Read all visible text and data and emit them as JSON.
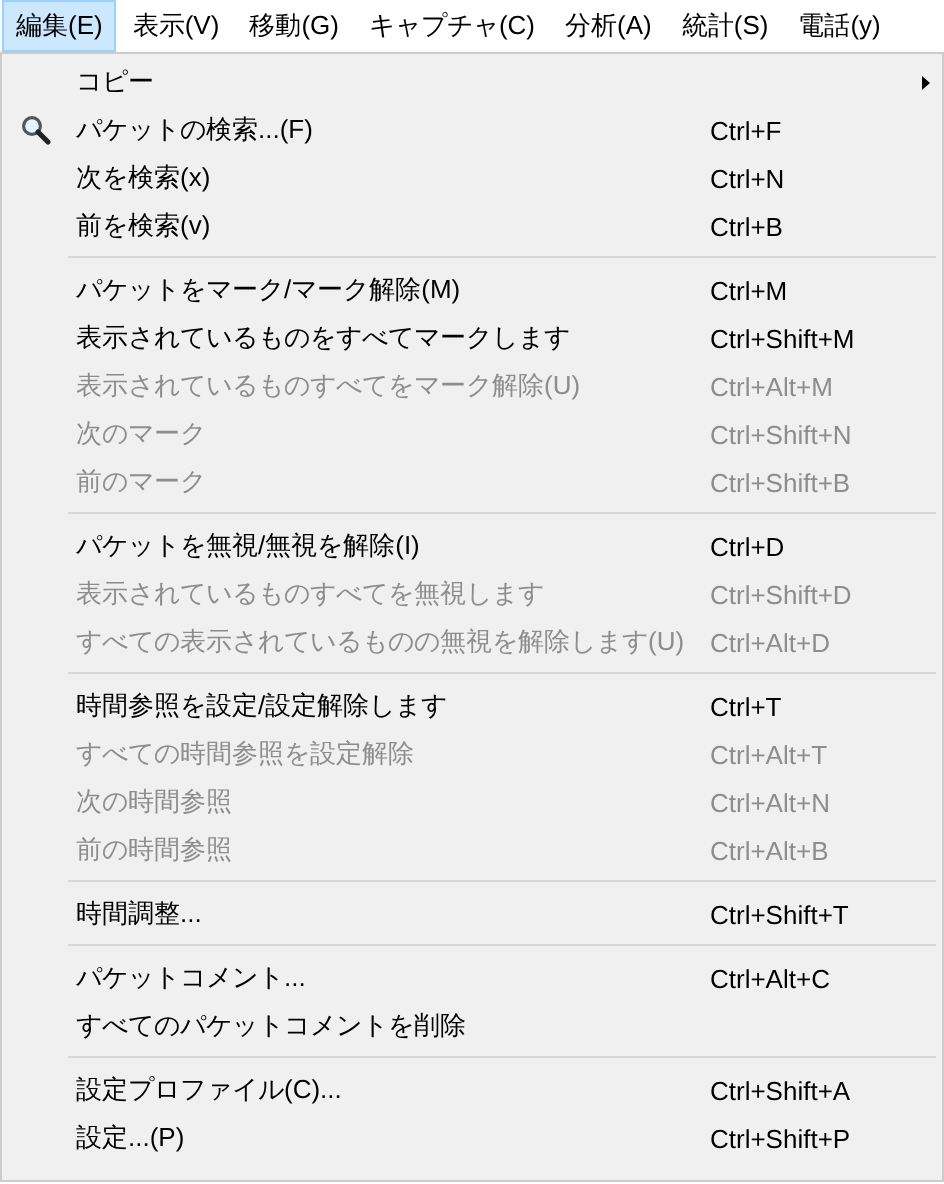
{
  "menubar": [
    {
      "label": "編集(E)",
      "selected": true
    },
    {
      "label": "表示(V)",
      "selected": false
    },
    {
      "label": "移動(G)",
      "selected": false
    },
    {
      "label": "キャプチャ(C)",
      "selected": false
    },
    {
      "label": "分析(A)",
      "selected": false
    },
    {
      "label": "統計(S)",
      "selected": false
    },
    {
      "label": "電話(y)",
      "selected": false
    }
  ],
  "menu": {
    "groups": [
      {
        "items": [
          {
            "label": "コピー",
            "kind": "submenu",
            "disabled": false
          },
          {
            "label": "パケットの検索...(F)",
            "shortcut": "Ctrl+F",
            "kind": "with-icon",
            "disabled": false
          },
          {
            "label": "次を検索(x)",
            "shortcut": "Ctrl+N",
            "kind": "plain",
            "disabled": false
          },
          {
            "label": "前を検索(v)",
            "shortcut": "Ctrl+B",
            "kind": "plain",
            "disabled": false
          }
        ]
      },
      {
        "items": [
          {
            "label": "パケットをマーク/マーク解除(M)",
            "shortcut": "Ctrl+M",
            "kind": "plain",
            "disabled": false
          },
          {
            "label": "表示されているものをすべてマークします",
            "shortcut": "Ctrl+Shift+M",
            "kind": "plain",
            "disabled": false
          },
          {
            "label": "表示されているものすべてをマーク解除(U)",
            "shortcut": "Ctrl+Alt+M",
            "kind": "plain",
            "disabled": true
          },
          {
            "label": "次のマーク",
            "shortcut": "Ctrl+Shift+N",
            "kind": "plain",
            "disabled": true
          },
          {
            "label": "前のマーク",
            "shortcut": "Ctrl+Shift+B",
            "kind": "plain",
            "disabled": true
          }
        ]
      },
      {
        "items": [
          {
            "label": "パケットを無視/無視を解除(I)",
            "shortcut": "Ctrl+D",
            "kind": "plain",
            "disabled": false
          },
          {
            "label": "表示されているものすべてを無視します",
            "shortcut": "Ctrl+Shift+D",
            "kind": "plain",
            "disabled": true
          },
          {
            "label": "すべての表示されているものの無視を解除します(U)",
            "shortcut": "Ctrl+Alt+D",
            "kind": "plain",
            "disabled": true
          }
        ]
      },
      {
        "items": [
          {
            "label": "時間参照を設定/設定解除します",
            "shortcut": "Ctrl+T",
            "kind": "plain",
            "disabled": false
          },
          {
            "label": "すべての時間参照を設定解除",
            "shortcut": "Ctrl+Alt+T",
            "kind": "plain",
            "disabled": true
          },
          {
            "label": "次の時間参照",
            "shortcut": "Ctrl+Alt+N",
            "kind": "plain",
            "disabled": true
          },
          {
            "label": "前の時間参照",
            "shortcut": "Ctrl+Alt+B",
            "kind": "plain",
            "disabled": true
          }
        ]
      },
      {
        "items": [
          {
            "label": "時間調整...",
            "shortcut": "Ctrl+Shift+T",
            "kind": "plain",
            "disabled": false
          }
        ]
      },
      {
        "items": [
          {
            "label": "パケットコメント...",
            "shortcut": "Ctrl+Alt+C",
            "kind": "plain",
            "disabled": false
          },
          {
            "label": "すべてのパケットコメントを削除",
            "kind": "plain",
            "disabled": false
          }
        ]
      },
      {
        "items": [
          {
            "label": "設定プロファイル(C)...",
            "shortcut": "Ctrl+Shift+A",
            "kind": "plain",
            "disabled": false
          },
          {
            "label": "設定...(P)",
            "shortcut": "Ctrl+Shift+P",
            "kind": "plain",
            "disabled": false
          }
        ]
      }
    ]
  }
}
